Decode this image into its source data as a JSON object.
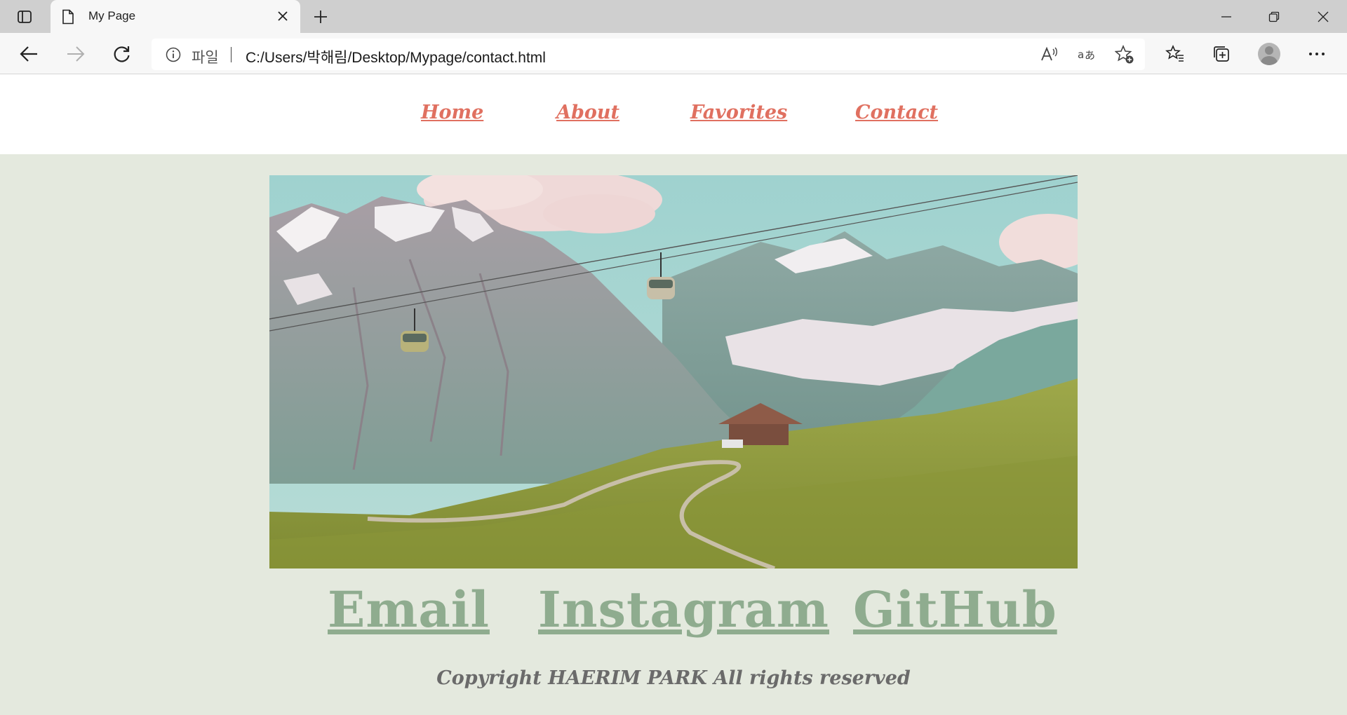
{
  "browser": {
    "tab_title": "My Page",
    "site_label": "파일",
    "url": "C:/Users/박해림/Desktop/Mypage/contact.html",
    "icons": [
      "tab-actions-icon",
      "page-icon",
      "close-icon",
      "plus-icon",
      "minimize-icon",
      "restore-icon",
      "close-window-icon",
      "back-arrow-icon",
      "forward-arrow-icon",
      "refresh-icon",
      "info-icon",
      "read-aloud-icon",
      "translate-icon",
      "add-favorite-icon",
      "favorites-icon",
      "collections-icon",
      "avatar",
      "more-icon"
    ]
  },
  "nav": {
    "items": [
      {
        "label": "Home"
      },
      {
        "label": "About"
      },
      {
        "label": "Favorites"
      },
      {
        "label": "Contact"
      }
    ],
    "color": "#e07060"
  },
  "hero": {
    "description": "Mountain landscape photo with cable cars and a chalet"
  },
  "contact": {
    "links": [
      {
        "label": "Email"
      },
      {
        "label": "Instagram"
      },
      {
        "label": "GitHub"
      }
    ],
    "color": "#8fac8f"
  },
  "footer": {
    "copyright": "Copyright HAERIM PARK All rights reserved"
  },
  "colors": {
    "page_background": "#e4e9de",
    "nav_background": "#ffffff"
  }
}
